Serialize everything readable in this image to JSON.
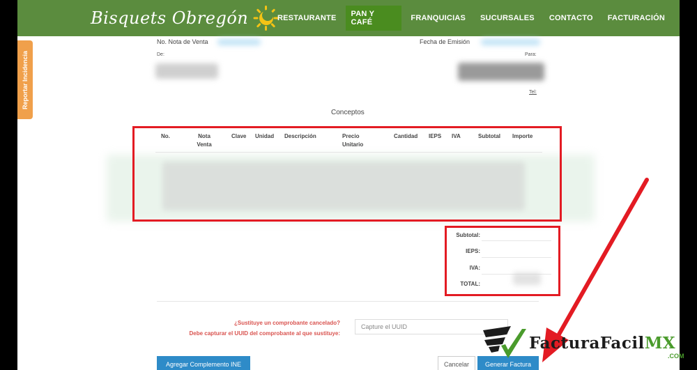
{
  "header": {
    "logo_text": "Bisquets Obregón",
    "nav": [
      {
        "label": "RESTAURANTE"
      },
      {
        "label": "PAN Y CAFÉ"
      },
      {
        "label": "FRANQUICIAS"
      },
      {
        "label": "SUCURSALES"
      },
      {
        "label": "CONTACTO"
      },
      {
        "label": "FACTURACIÓN"
      }
    ]
  },
  "side_tab": {
    "label": "Reportar Incidencia"
  },
  "invoice": {
    "nota_label": "No. Nota de Venta",
    "fecha_label": "Fecha de Emisión",
    "de_label": "De:",
    "para_label": "Para:",
    "tel_label": "Tel:"
  },
  "concepts": {
    "title": "Conceptos",
    "columns": [
      "No.",
      "Nota Venta",
      "Clave",
      "Unidad",
      "Descripción",
      "Precio Unitario",
      "Cantidad",
      "IEPS",
      "IVA",
      "Subtotal",
      "Importe"
    ]
  },
  "totals": {
    "subtotal": "Subtotal:",
    "ieps": "IEPS:",
    "iva": "IVA:",
    "total": "TOTAL:"
  },
  "replace": {
    "question": "¿Sustituye un comprobante cancelado?",
    "instruction": "Debe capturar el UUID del comprobante al que sustituye:",
    "uuid_placeholder": "Capture el UUID"
  },
  "buttons": {
    "ine": "Agregar Complemento INE",
    "cancel": "Cancelar",
    "generate": "Generar Factura"
  },
  "watermark": {
    "main": "FacturaFacil",
    "suffix": "MX",
    "com": ".COM"
  },
  "colors": {
    "header_green": "#5b8c3e",
    "highlight_red": "#e31b23",
    "button_blue": "#2e8bc8",
    "side_tab_orange": "#f0a04b",
    "warning_red": "#d9534f"
  }
}
